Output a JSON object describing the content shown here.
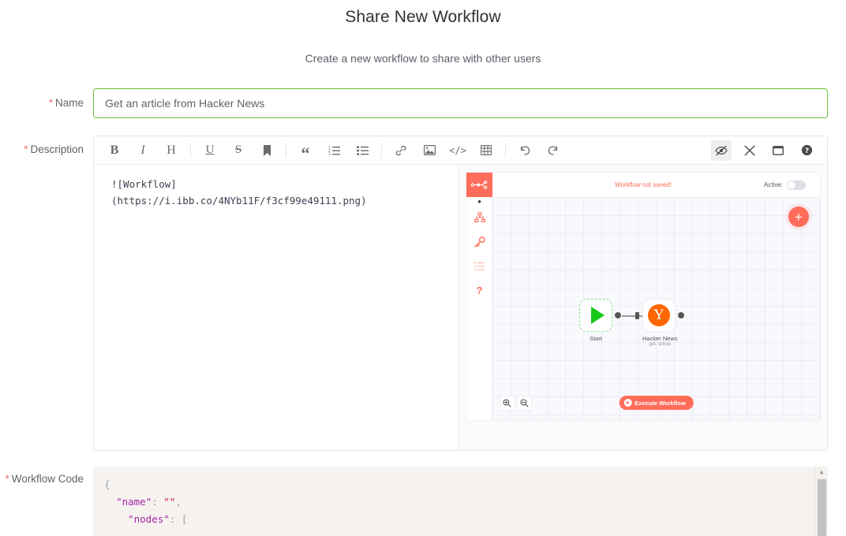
{
  "header": {
    "title": "Share New Workflow",
    "subtitle": "Create a new workflow to share with other users"
  },
  "form": {
    "name": {
      "label": "Name",
      "required_marker": "*",
      "value": "Get an article from Hacker News",
      "placeholder": "",
      "border_color": "#67c23a"
    },
    "description": {
      "label": "Description",
      "required_marker": "*",
      "markdown_lines": [
        "![Workflow]",
        "(https://i.ibb.co/4NYb11F/f3cf99e49111.png)"
      ]
    },
    "workflow_code": {
      "label": "Workflow Code",
      "required_marker": "*",
      "lines": [
        {
          "indent": "",
          "punc_open": "{"
        },
        {
          "indent": "  ",
          "key": "\"name\"",
          "colon": ": ",
          "value": "\"\"",
          "trail": ","
        },
        {
          "indent": "    ",
          "key": "\"nodes\"",
          "colon": ": ",
          "value": "",
          "trail": "["
        }
      ]
    }
  },
  "editor_toolbar": {
    "left_buttons": [
      {
        "name": "bold-icon",
        "label": "B"
      },
      {
        "name": "italic-icon",
        "label": "I"
      },
      {
        "name": "heading-icon",
        "label": "H"
      },
      {
        "name": "underline-icon",
        "label": "U"
      },
      {
        "name": "strikethrough-icon",
        "label": "S"
      },
      {
        "name": "bookmark-icon",
        "label": "▐"
      },
      {
        "name": "quote-icon",
        "label": "“"
      },
      {
        "name": "ordered-list-icon",
        "label": ""
      },
      {
        "name": "unordered-list-icon",
        "label": ""
      },
      {
        "name": "link-icon",
        "label": ""
      },
      {
        "name": "image-icon",
        "label": ""
      },
      {
        "name": "code-icon",
        "label": "</>"
      },
      {
        "name": "table-icon",
        "label": ""
      },
      {
        "name": "undo-icon",
        "label": "↺"
      },
      {
        "name": "redo-icon",
        "label": "↻"
      }
    ],
    "right_buttons": [
      {
        "name": "toggle-preview-icon",
        "active": true
      },
      {
        "name": "fullscreen-icon",
        "active": false
      },
      {
        "name": "window-icon",
        "active": false
      },
      {
        "name": "help-icon",
        "active": false
      }
    ]
  },
  "preview": {
    "workflow_canvas": {
      "status_text": "Workflow not saved!",
      "status_color": "#ff6d5a",
      "active_label": "Active:",
      "active_on": false,
      "add_button_label": "+",
      "execute_button_label": "Execute Workflow",
      "sidebar_icons": [
        "n8n-logo-icon",
        "workflows-icon",
        "credentials-key-icon",
        "executions-list-icon",
        "help-question-icon"
      ],
      "zoom_buttons": [
        "zoom-in-icon",
        "zoom-out-icon"
      ],
      "nodes": [
        {
          "name": "Start",
          "subtitle": "",
          "type": "trigger"
        },
        {
          "name": "Hacker News",
          "subtitle": "get: article",
          "type": "hackernews",
          "glyph": "Y"
        }
      ]
    }
  }
}
